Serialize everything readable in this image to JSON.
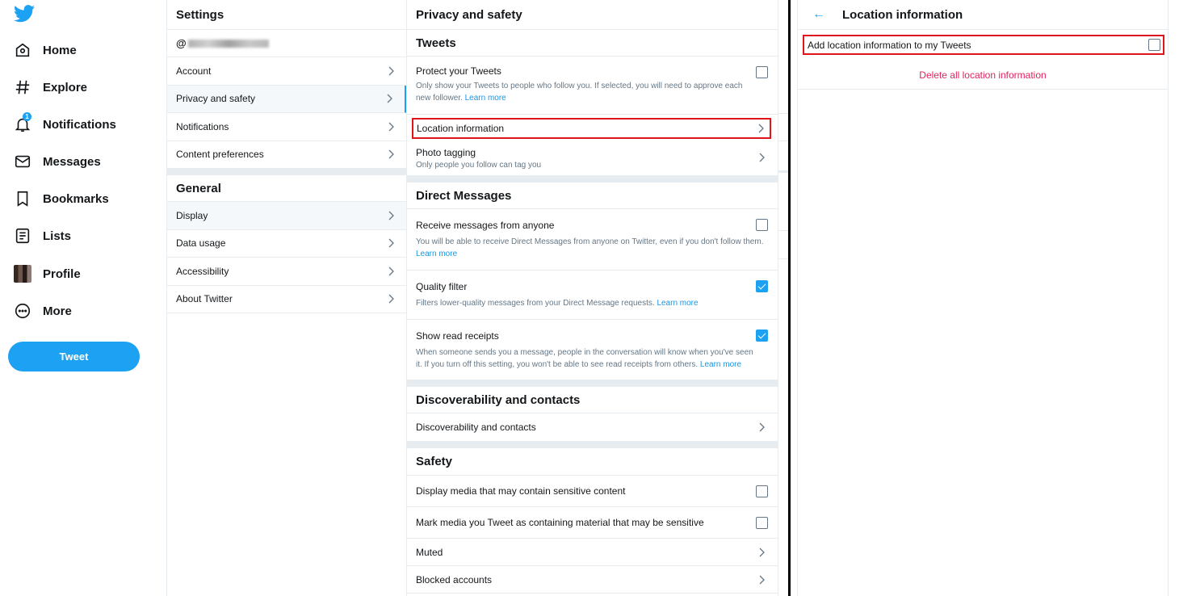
{
  "nav": {
    "items": [
      {
        "label": "Home",
        "icon": "home-icon"
      },
      {
        "label": "Explore",
        "icon": "hashtag-icon"
      },
      {
        "label": "Notifications",
        "icon": "bell-icon",
        "badge": "1"
      },
      {
        "label": "Messages",
        "icon": "envelope-icon"
      },
      {
        "label": "Bookmarks",
        "icon": "bookmark-icon"
      },
      {
        "label": "Lists",
        "icon": "list-icon"
      },
      {
        "label": "Profile",
        "icon": "avatar"
      },
      {
        "label": "More",
        "icon": "more-icon"
      }
    ],
    "tweet_button": "Tweet"
  },
  "settings": {
    "title": "Settings",
    "handle_prefix": "@",
    "items": [
      "Account",
      "Privacy and safety",
      "Notifications",
      "Content preferences"
    ],
    "general_title": "General",
    "general_items": [
      "Display",
      "Data usage",
      "Accessibility",
      "About Twitter"
    ]
  },
  "privacy": {
    "title": "Privacy and safety",
    "tweets_title": "Tweets",
    "protect_label": "Protect your Tweets",
    "protect_desc": "Only show your Tweets to people who follow you. If selected, you will need to approve each new follower.",
    "learn_more": "Learn more",
    "location_label": "Location information",
    "photo_label": "Photo tagging",
    "photo_desc": "Only people you follow can tag you",
    "dm_title": "Direct Messages",
    "receive_label": "Receive messages from anyone",
    "receive_desc": "You will be able to receive Direct Messages from anyone on Twitter, even if you don't follow them.",
    "quality_label": "Quality filter",
    "quality_desc": "Filters lower-quality messages from your Direct Message requests.",
    "receipts_label": "Show read receipts",
    "receipts_desc": "When someone sends you a message, people in the conversation will know when you've seen it. If you turn off this setting, you won't be able to see read receipts from others.",
    "disc_title": "Discoverability and contacts",
    "disc_label": "Discoverability and contacts",
    "safety_title": "Safety",
    "sensitive_label": "Display media that may contain sensitive content",
    "mark_label": "Mark media you Tweet as containing material that may be sensitive",
    "muted_label": "Muted",
    "blocked_label": "Blocked accounts"
  },
  "location": {
    "back": "←",
    "title": "Location information",
    "add_label": "Add location information to my Tweets",
    "delete_link": "Delete all location information"
  },
  "colors": {
    "accent": "#1da1f2",
    "danger": "#e0245e",
    "highlight": "#e0151c"
  }
}
